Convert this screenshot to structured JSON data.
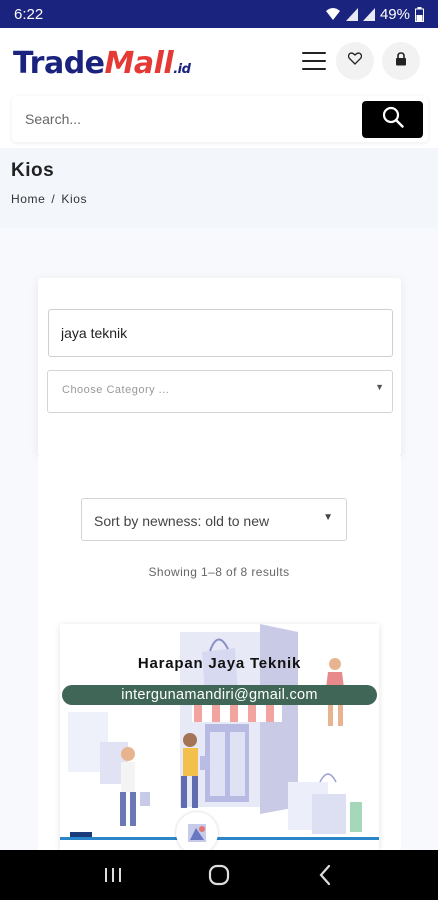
{
  "status": {
    "time": "6:22",
    "battery": "49%",
    "icons": [
      "wifi-icon",
      "signal-icon",
      "signal-icon",
      "battery-icon"
    ]
  },
  "header": {
    "logo_trade": "Trade",
    "logo_mall": "Mall",
    "logo_suffix": ".id",
    "icons": [
      "menu-icon",
      "heart-icon",
      "lock-icon"
    ]
  },
  "search": {
    "placeholder": "Search...",
    "button_icon": "search-icon"
  },
  "page": {
    "title": "Kios",
    "breadcrumb": [
      "Home",
      "/",
      "Kios"
    ]
  },
  "filter": {
    "keyword_value": "jaya teknik",
    "category_placeholder": "Choose Category ...",
    "sort_label": "Sort by newness: old to new"
  },
  "results": {
    "count_text": "Showing 1–8 of 8 results"
  },
  "stores": [
    {
      "name": "Harapan Jaya Teknik",
      "email": "intergunamandiri@gmail.com"
    }
  ],
  "colors": {
    "status_bar": "#1a237e",
    "brand_blue": "#1a237e",
    "brand_red": "#e53935",
    "email_pill": "#3f6656"
  },
  "navbar": {
    "icons": [
      "recent-apps-icon",
      "home-icon",
      "back-icon"
    ]
  }
}
